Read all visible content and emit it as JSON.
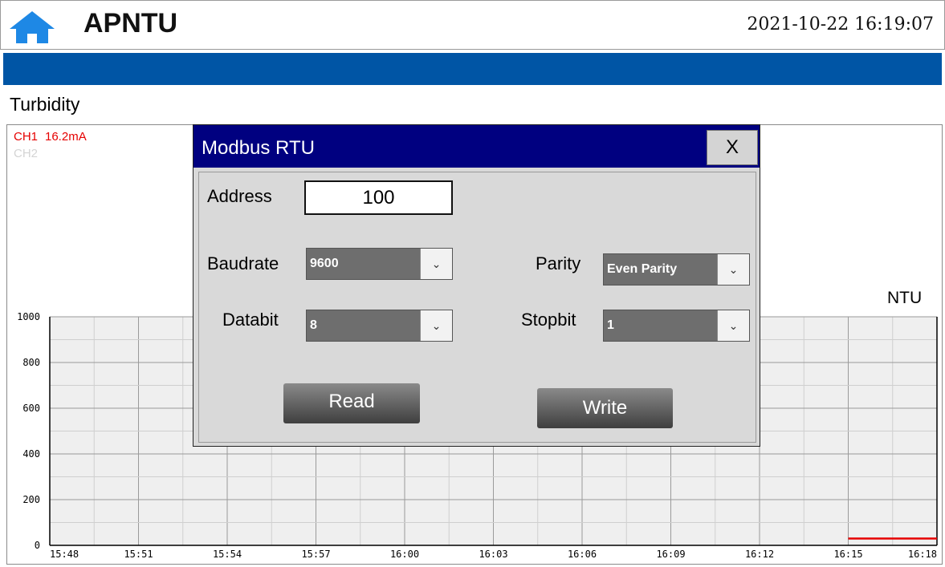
{
  "header": {
    "title": "APNTU",
    "datetime": "2021-10-22 16:19:07",
    "icon": "home-icon"
  },
  "colors": {
    "header_bar": "#0055a5",
    "dialog_titlebar": "#000080",
    "ch1": "#e60000",
    "ch2": "#d4d4d4"
  },
  "section": {
    "title": "Turbidity"
  },
  "chart": {
    "ch1_label": "CH1",
    "ch1_value": "16.2mA",
    "ch2_label": "CH2",
    "unit": "NTU"
  },
  "chart_data": {
    "type": "line",
    "x_ticks": [
      "15:48",
      "15:51",
      "15:54",
      "15:57",
      "16:00",
      "16:03",
      "16:06",
      "16:09",
      "16:12",
      "16:15",
      "16:18"
    ],
    "y_ticks": [
      "1000",
      "800",
      "600",
      "400",
      "200",
      "0"
    ],
    "ylim": [
      0,
      1000
    ],
    "grid": true,
    "series": [
      {
        "name": "CH1",
        "color": "#e60000",
        "x": [
          "16:15",
          "16:18"
        ],
        "values": [
          30,
          30
        ]
      }
    ]
  },
  "dialog": {
    "title": "Modbus RTU",
    "close_label": "X",
    "address_label": "Address",
    "address_value": "100",
    "baudrate_label": "Baudrate",
    "baudrate_value": "9600",
    "parity_label": "Parity",
    "parity_value": "Even Parity",
    "databit_label": "Databit",
    "databit_value": "8",
    "stopbit_label": "Stopbit",
    "stopbit_value": "1",
    "read_label": "Read",
    "write_label": "Write",
    "dropdown_icon": "chevron-down-icon"
  }
}
